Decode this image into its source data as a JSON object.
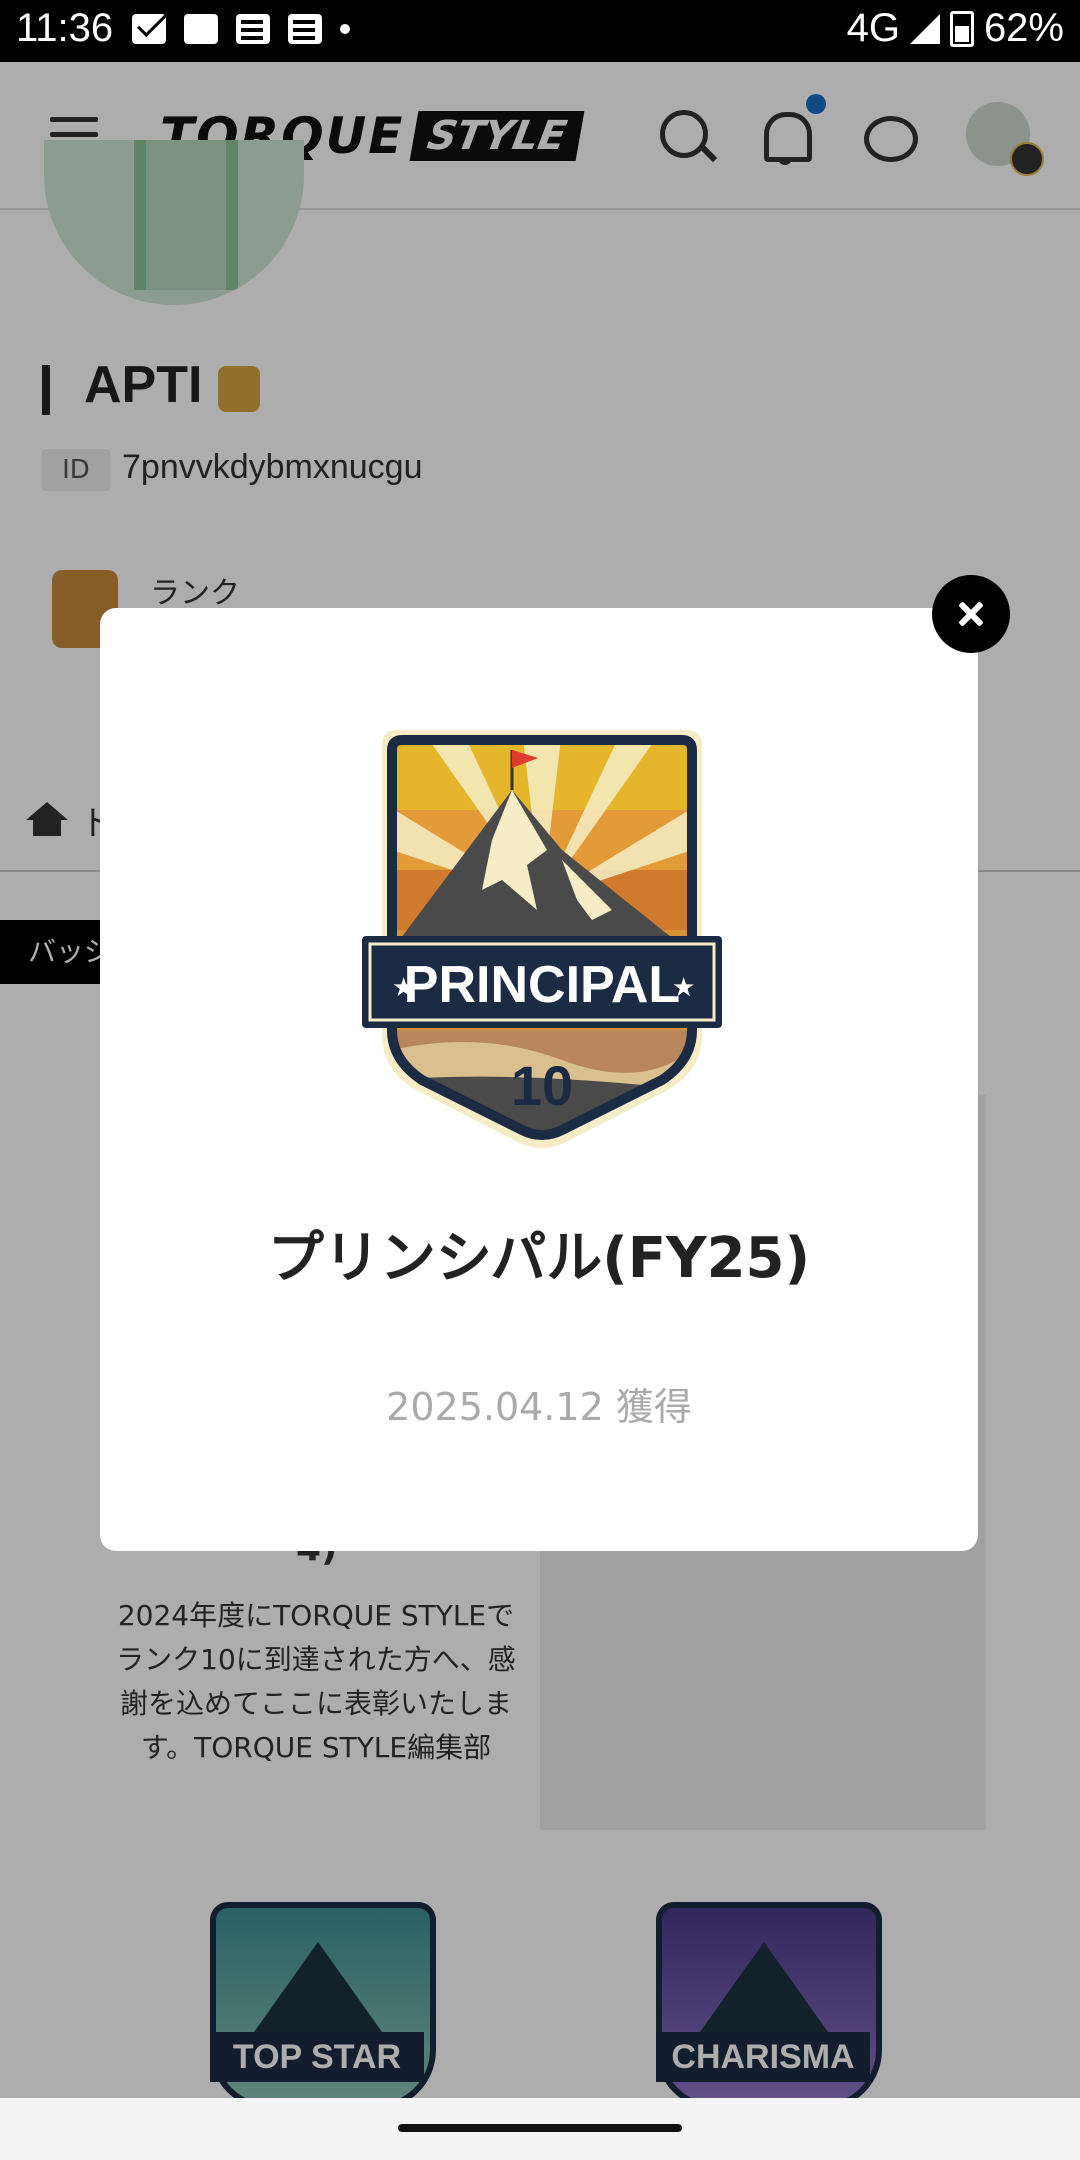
{
  "status_bar": {
    "time": "11:36",
    "network": "4G",
    "battery": "62%"
  },
  "header": {
    "logo_main": "TORQUE",
    "logo_sub": "STYLE"
  },
  "profile": {
    "name": "APTI",
    "id_label": "ID",
    "id_value": "7pnvvkdybmxnucgu",
    "rank_label": "ランク"
  },
  "breadcrumb": {
    "home_text": "ト"
  },
  "tab": {
    "label": "バッジ"
  },
  "card": {
    "title_fragment": "4)",
    "description": "2024年度にTORQUE STYLEでランク10に到達された方へ、感謝を込めてここに表彰いたします。TORQUE STYLE編集部"
  },
  "badges_below": [
    {
      "label": "TOP STAR"
    },
    {
      "label": "CHARISMA"
    }
  ],
  "modal": {
    "badge_label": "PRINCIPAL",
    "badge_number": "10",
    "title": "プリンシパル(FY25)",
    "date": "2025.04.12 獲得"
  },
  "colors": {
    "accent": "#1a6fc4",
    "badge_navy": "#1b2b44",
    "badge_gold": "#e0b232"
  }
}
